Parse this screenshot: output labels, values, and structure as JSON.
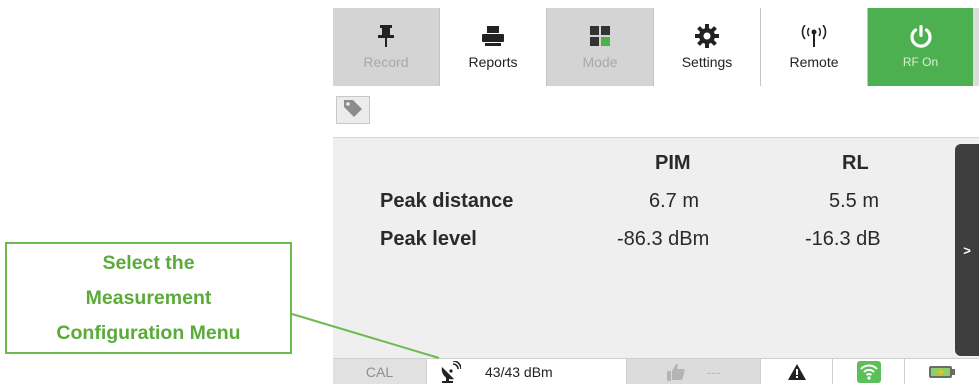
{
  "toolbar": {
    "record": {
      "label": "Record",
      "icon": "pin-icon"
    },
    "reports": {
      "label": "Reports",
      "icon": "printer-icon"
    },
    "mode": {
      "label": "Mode",
      "icon": "grid-icon"
    },
    "settings": {
      "label": "Settings",
      "icon": "gear-icon"
    },
    "remote": {
      "label": "Remote",
      "icon": "antenna-icon"
    },
    "rf": {
      "label": "RF On",
      "icon": "power-icon"
    }
  },
  "results": {
    "columns": [
      "PIM",
      "RL"
    ],
    "rows": [
      {
        "label": "Peak distance",
        "values": [
          "6.7 m",
          "5.5 m"
        ]
      },
      {
        "label": "Peak level",
        "values": [
          "-86.3 dBm",
          "-16.3 dB"
        ]
      }
    ]
  },
  "side_tab": {
    "label": ">"
  },
  "status_bar": {
    "cal": "CAL",
    "signal": "43/43 dBm",
    "thumb_value": "---"
  },
  "callout": {
    "lines": [
      "Select the",
      "Measurement",
      "Configuration Menu"
    ]
  },
  "colors": {
    "accent_green": "#4caf50",
    "callout_green": "#5aab3a"
  }
}
